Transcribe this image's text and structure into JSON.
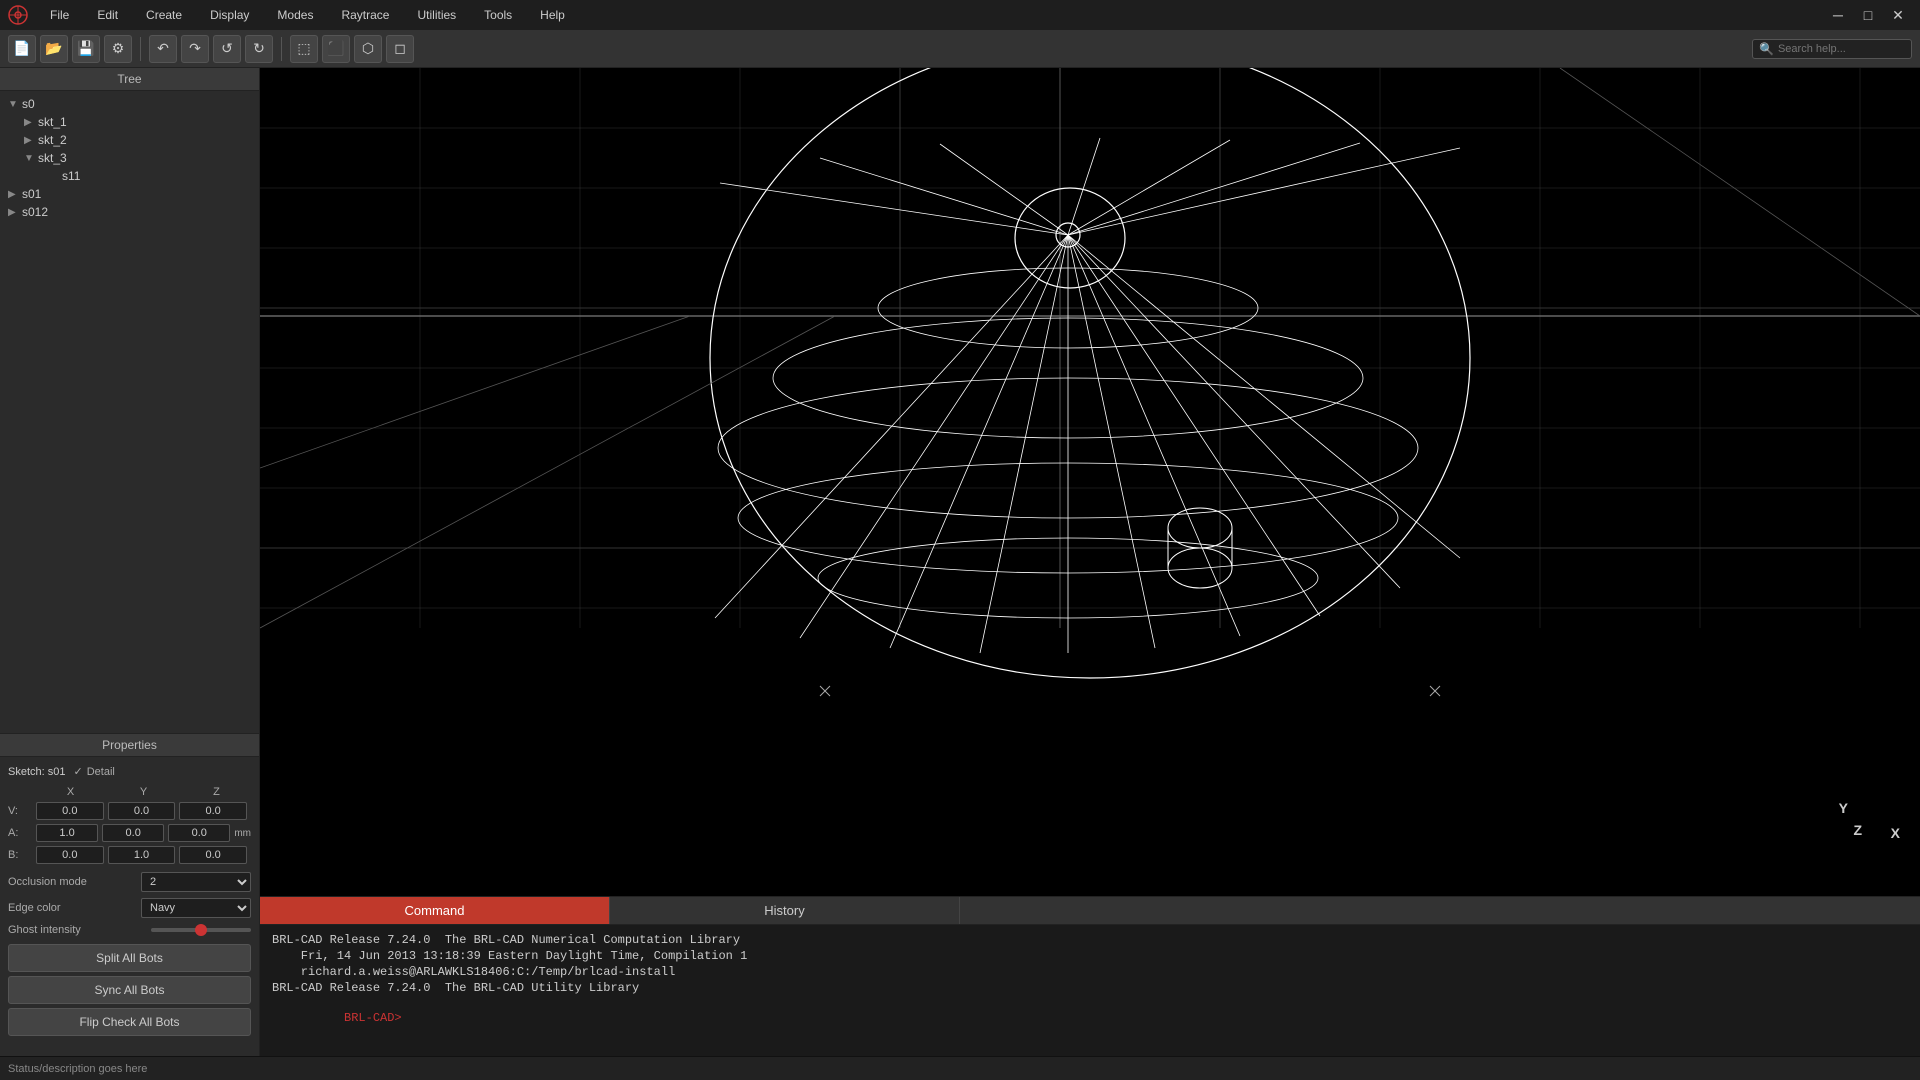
{
  "app": {
    "title": "BRL-CAD",
    "logo_symbol": "⊙"
  },
  "menu": {
    "items": [
      "File",
      "Edit",
      "Create",
      "Display",
      "Modes",
      "Raytrace",
      "Utilities",
      "Tools",
      "Help"
    ]
  },
  "toolbar": {
    "buttons": [
      {
        "name": "new-file",
        "symbol": "📄"
      },
      {
        "name": "open-file",
        "symbol": "📂"
      },
      {
        "name": "save-file",
        "symbol": "💾"
      },
      {
        "name": "preferences",
        "symbol": "⚙"
      },
      {
        "name": "undo",
        "symbol": "↶"
      },
      {
        "name": "redo1",
        "symbol": "↷"
      },
      {
        "name": "undo2",
        "symbol": "↺"
      },
      {
        "name": "redo2",
        "symbol": "↻"
      },
      {
        "name": "select",
        "symbol": "⬚"
      },
      {
        "name": "zoom",
        "symbol": "⬛"
      },
      {
        "name": "view3d",
        "symbol": "⬡"
      },
      {
        "name": "render",
        "symbol": "◻"
      }
    ],
    "search_placeholder": "Search help..."
  },
  "tree": {
    "header": "Tree",
    "items": [
      {
        "id": "s0",
        "label": "s0",
        "level": 0,
        "expanded": true,
        "type": "folder"
      },
      {
        "id": "skt_1",
        "label": "skt_1",
        "level": 1,
        "expanded": false,
        "type": "leaf"
      },
      {
        "id": "skt_2",
        "label": "skt_2",
        "level": 1,
        "expanded": false,
        "type": "leaf"
      },
      {
        "id": "skt_3",
        "label": "skt_3",
        "level": 1,
        "expanded": true,
        "type": "folder"
      },
      {
        "id": "s11",
        "label": "s11",
        "level": 2,
        "expanded": false,
        "type": "leaf"
      },
      {
        "id": "s01",
        "label": "s01",
        "level": 0,
        "expanded": false,
        "type": "leaf"
      },
      {
        "id": "s012",
        "label": "s012",
        "level": 0,
        "expanded": false,
        "type": "leaf"
      }
    ]
  },
  "properties": {
    "header": "Properties",
    "sketch_label": "Sketch: s01",
    "detail_label": "Detail",
    "detail_checked": true,
    "coords": {
      "headers": [
        "X",
        "Y",
        "Z"
      ],
      "rows": [
        {
          "label": "V:",
          "x": "0.0",
          "y": "0.0",
          "z": "0.0",
          "unit": ""
        },
        {
          "label": "A:",
          "x": "1.0",
          "y": "0.0",
          "z": "0.0",
          "unit": "mm"
        },
        {
          "label": "B:",
          "x": "0.0",
          "y": "1.0",
          "z": "0.0",
          "unit": ""
        }
      ]
    },
    "occlusion_label": "Occlusion mode",
    "occlusion_value": "2",
    "edge_color_label": "Edge color",
    "edge_color_value": "Navy",
    "ghost_intensity_label": "Ghost intensity",
    "ghost_intensity_value": "8",
    "buttons": [
      {
        "name": "split-all-bots",
        "label": "Split All Bots"
      },
      {
        "name": "sync-all-bots",
        "label": "Sync All Bots"
      },
      {
        "name": "flip-check-all-bots",
        "label": "Flip Check All Bots"
      }
    ]
  },
  "tabs": {
    "command_label": "Command",
    "history_label": "History"
  },
  "console": {
    "lines": [
      "BRL-CAD Release 7.24.0  The BRL-CAD Numerical Computation Library",
      "    Fri, 14 Jun 2013 13:18:39 Eastern Daylight Time, Compilation 1",
      "    richard.a.weiss@ARLAWKLS18406:C:/Temp/brlcad-install",
      "BRL-CAD Release 7.24.0  The BRL-CAD Utility Library"
    ],
    "prompt": "BRL-CAD>"
  },
  "statusbar": {
    "text": "Status/description goes here"
  },
  "viewport": {
    "axis": {
      "x_label": "X",
      "y_label": "Y",
      "z_label": "Z"
    }
  }
}
